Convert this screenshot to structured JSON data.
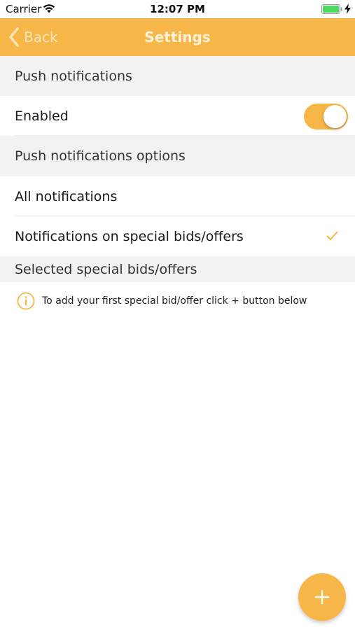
{
  "status_bar": {
    "carrier": "Carrier",
    "time": "12:07 PM"
  },
  "nav": {
    "back_label": "Back",
    "title": "Settings"
  },
  "sections": {
    "push": {
      "header": "Push notifications",
      "enabled_label": "Enabled",
      "enabled": true
    },
    "options": {
      "header": "Push notifications options",
      "all_label": "All notifications",
      "special_label": "Notifications on special bids/offers",
      "selected_option": "special"
    },
    "selected": {
      "header": "Selected special bids/offers",
      "info_text": "To add your first special bid/offer click + button below"
    }
  },
  "colors": {
    "accent": "#f7b748",
    "section_background": "#f2f2f2",
    "battery": "#4cd964"
  },
  "icons": {
    "back": "chevron-left-icon",
    "wifi": "wifi-icon",
    "battery": "battery-icon",
    "charging": "bolt-icon",
    "check": "checkmark-icon",
    "info": "info-icon",
    "add": "plus-icon"
  }
}
